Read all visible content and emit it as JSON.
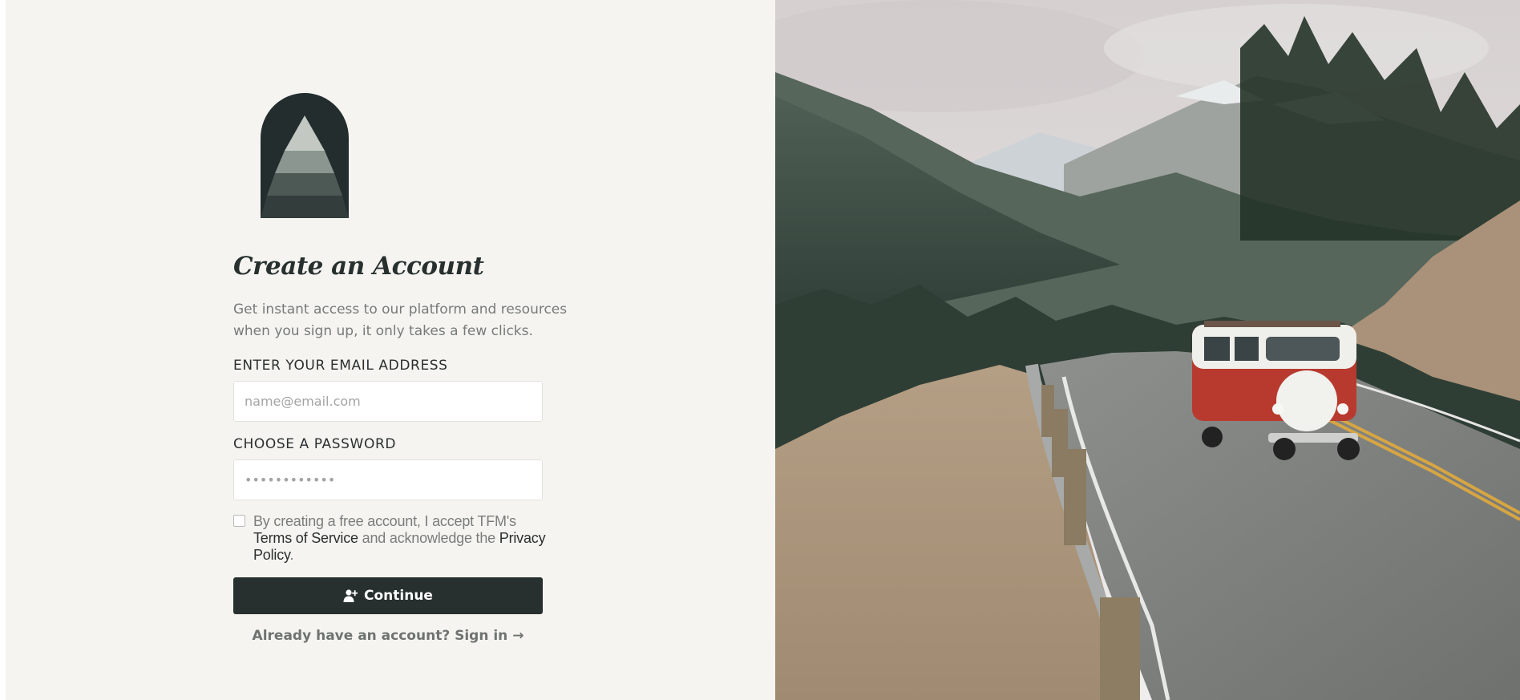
{
  "brand": {
    "logo_icon": "pine-tree-arch-logo-icon",
    "colors": {
      "dark": "#27302f",
      "background": "#f5f4f0"
    }
  },
  "signup": {
    "title": "Create an Account",
    "subtitle": "Get instant access to our platform and resources when you sign up, it only takes a few clicks.",
    "email": {
      "label": "ENTER YOUR EMAIL ADDRESS",
      "placeholder": "name@email.com"
    },
    "password": {
      "label": "CHOOSE A PASSWORD",
      "placeholder": "••••••••••••"
    },
    "terms": {
      "text_before": "By creating a free account, I accept TFM's ",
      "terms_link": "Terms of Service",
      "text_middle": " and acknowledge the ",
      "privacy_link": "Privacy Policy",
      "text_after": "."
    },
    "continue_label": "Continue",
    "continue_icon": "add-user-icon",
    "signin_link": "Already have an account? Sign in →"
  },
  "hero_image": {
    "subject": "red-camper-van-mountain-road-photo"
  }
}
